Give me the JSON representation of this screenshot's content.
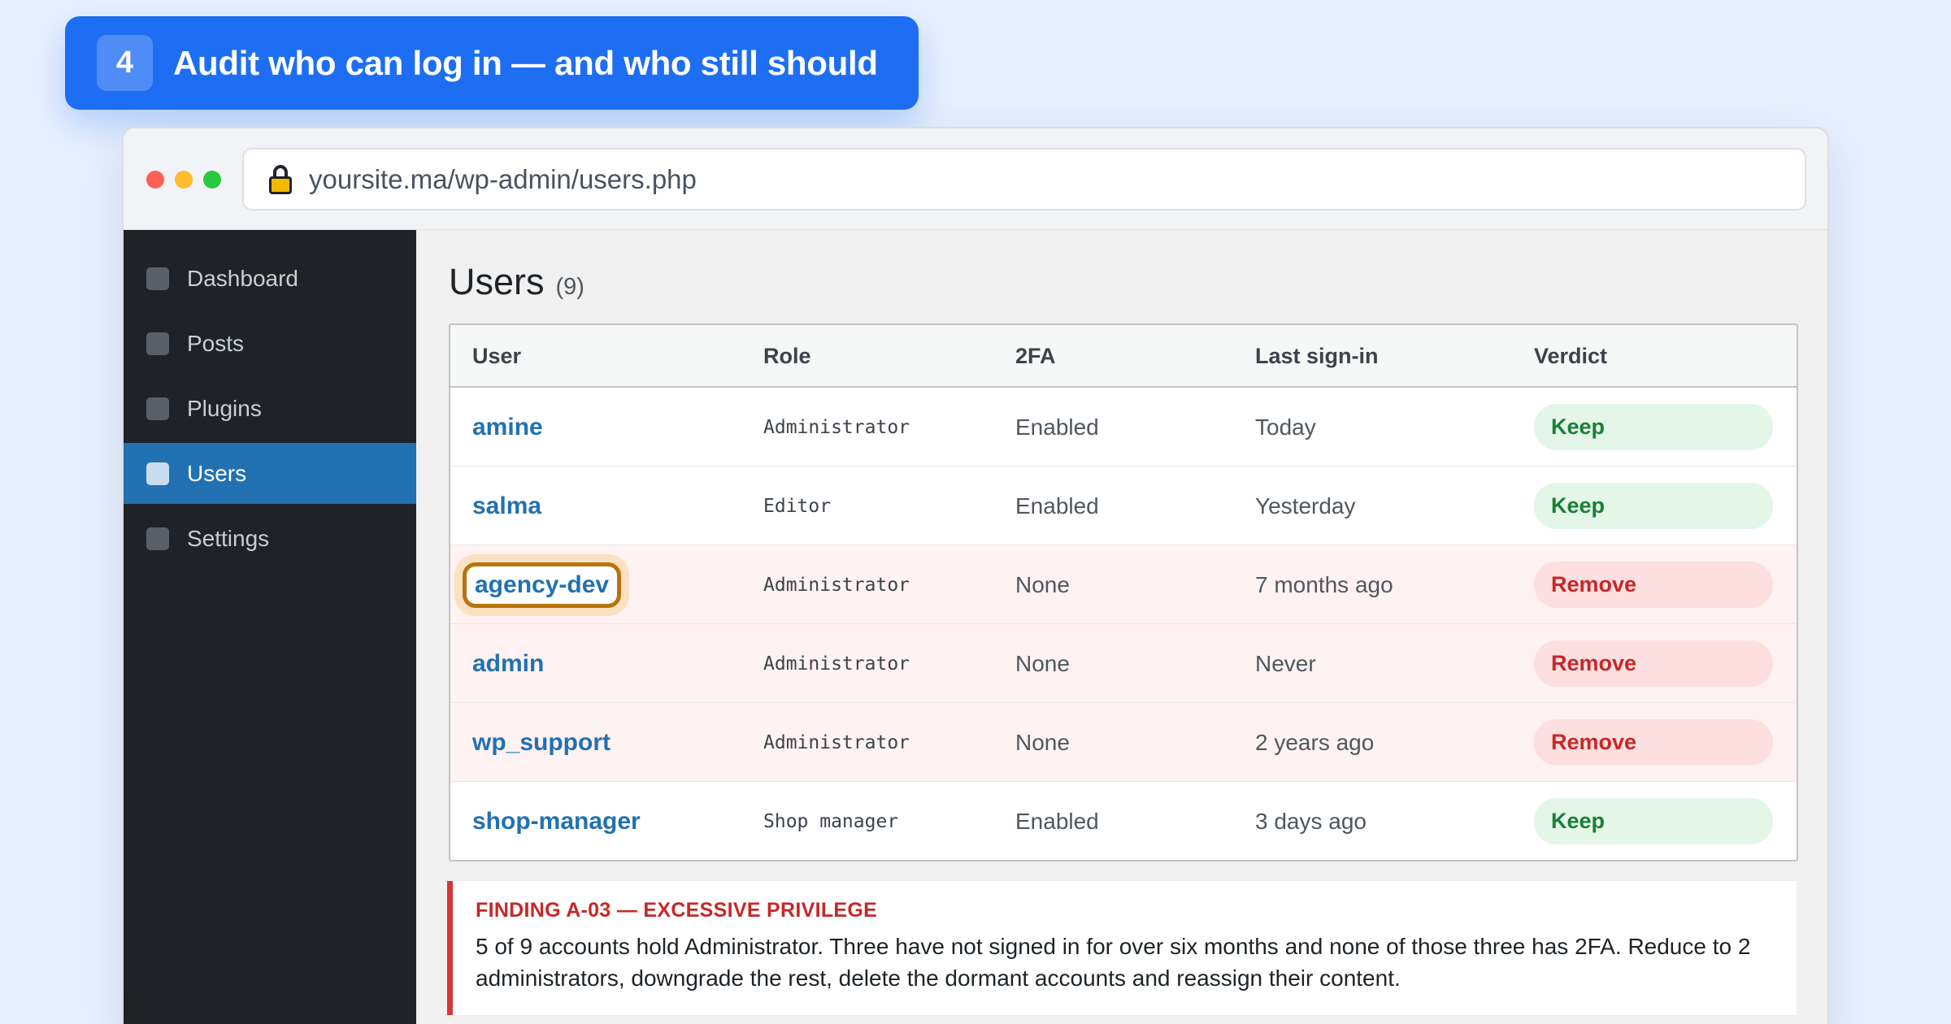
{
  "banner": {
    "step": "4",
    "title": "Audit who can log in — and who still should"
  },
  "browser": {
    "url": "yoursite.ma/wp-admin/users.php"
  },
  "sidebar": {
    "items": [
      {
        "label": "Dashboard",
        "active": false
      },
      {
        "label": "Posts",
        "active": false
      },
      {
        "label": "Plugins",
        "active": false
      },
      {
        "label": "Users",
        "active": true
      },
      {
        "label": "Settings",
        "active": false
      }
    ]
  },
  "main": {
    "title": "Users",
    "count": "(9)"
  },
  "table": {
    "headers": {
      "user": "User",
      "role": "Role",
      "twofa": "2FA",
      "last": "Last sign-in",
      "verdict": "Verdict"
    },
    "rows": [
      {
        "user": "amine",
        "role": "Administrator",
        "twofa": "Enabled",
        "last": "Today",
        "verdict": "Keep"
      },
      {
        "user": "salma",
        "role": "Editor",
        "twofa": "Enabled",
        "last": "Yesterday",
        "verdict": "Keep"
      },
      {
        "user": "agency-dev",
        "role": "Administrator",
        "twofa": "None",
        "last": "7 months ago",
        "verdict": "Remove"
      },
      {
        "user": "admin",
        "role": "Administrator",
        "twofa": "None",
        "last": "Never",
        "verdict": "Remove"
      },
      {
        "user": "wp_support",
        "role": "Administrator",
        "twofa": "None",
        "last": "2 years ago",
        "verdict": "Remove"
      },
      {
        "user": "shop-manager",
        "role": "Shop manager",
        "twofa": "Enabled",
        "last": "3 days ago",
        "verdict": "Keep"
      }
    ]
  },
  "finding": {
    "title": "FINDING A-03 — EXCESSIVE PRIVILEGE",
    "body": "5 of 9 accounts hold Administrator. Three have not signed in for over six months and none of those three has 2FA. Reduce to 2 administrators, downgrade the rest, delete the dormant accounts and reassign their content."
  },
  "colors": {
    "accent": "#1d6ef2",
    "wp_blue": "#2271b1",
    "keep": "#1a7f37",
    "remove": "#c62828",
    "highlight": "#b7740c"
  }
}
